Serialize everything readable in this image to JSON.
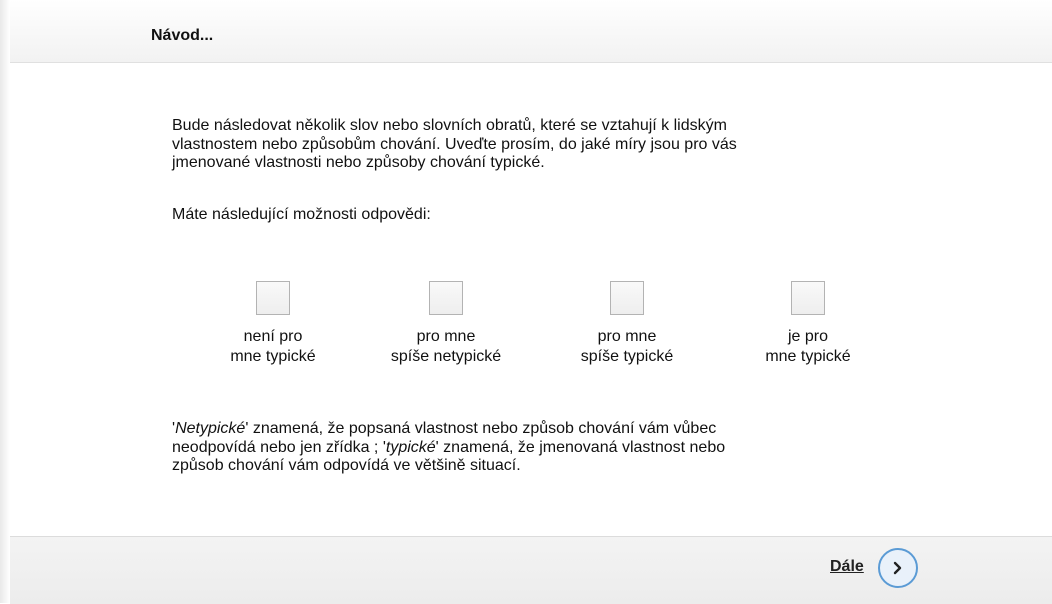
{
  "header": {
    "title": "Návod..."
  },
  "intro": {
    "lines": [
      "Bude následovat několik slov nebo slovních obratů, které se vztahují k lidským",
      "vlastnostem nebo způsobům chování. Uveďte prosím, do jaké míry jsou pro vás",
      "jmenované vlastnosti nebo způsoby chování typické."
    ]
  },
  "options_intro": "Máte následující možnosti odpovědi:",
  "options": [
    {
      "line1": "není pro",
      "line2": "mne typické"
    },
    {
      "line1": "pro mne",
      "line2": "spíše netypické"
    },
    {
      "line1": "pro mne",
      "line2": "spíše typické"
    },
    {
      "line1": "je pro",
      "line2": "mne typické"
    }
  ],
  "footnote": {
    "quote_open": "'",
    "term_negative": "Netypické",
    "part1": "' znamená, že popsaná vlastnost nebo způsob chování vám vůbec",
    "part2": "neodpovídá nebo jen zřídka ; '",
    "term_positive": "typické",
    "part3": "' znamená, že jmenovaná vlastnost nebo",
    "part4": "způsob chování vám odpovídá ve většině situací."
  },
  "footer": {
    "next_label": "Dále",
    "next_icon": "chevron-right-icon",
    "accent_color": "#5b9bd5"
  }
}
